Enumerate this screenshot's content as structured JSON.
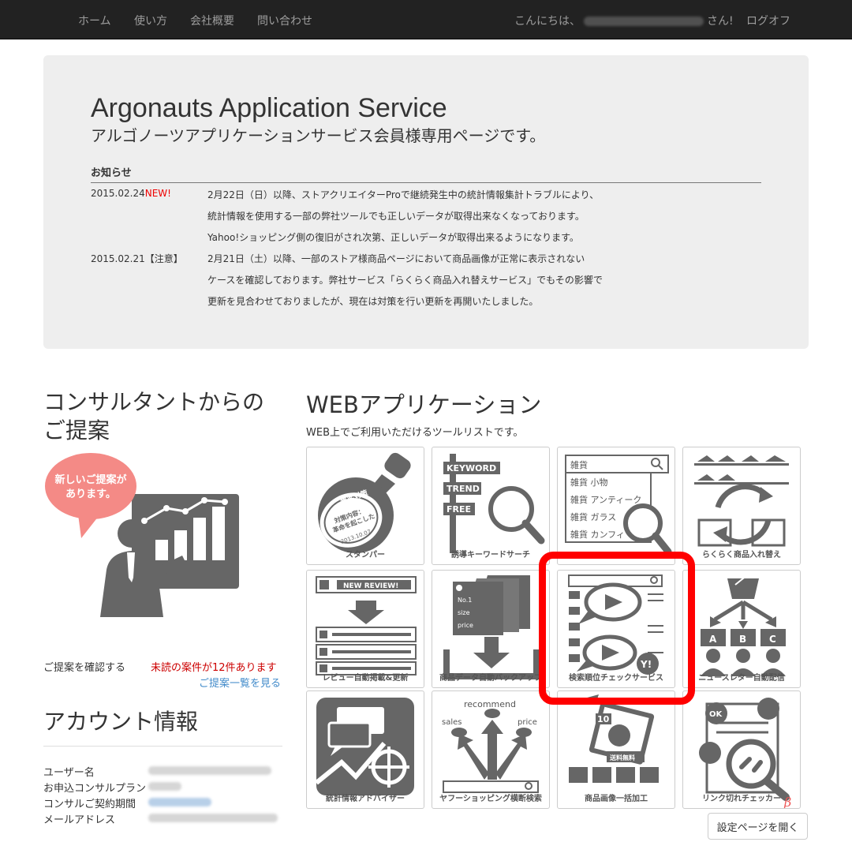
{
  "nav": {
    "items": [
      "ホーム",
      "使い方",
      "会社概要",
      "問い合わせ"
    ],
    "greeting_prefix": "こんにちは、",
    "greeting_suffix": "さん!",
    "logout": "ログオフ"
  },
  "hero": {
    "title": "Argonauts Application Service",
    "subtitle": "アルゴノーツアプリケーションサービス会員様専用ページです。",
    "notice_heading": "お知らせ",
    "notices": [
      {
        "date": "2015.02.24",
        "tag": "NEW!",
        "lines": [
          "2月22日（日）以降、ストアクリエイターProで継続発生中の統計情報集計トラブルにより、",
          "統計情報を使用する一部の弊社ツールでも正しいデータが取得出来なくなっております。",
          "Yahoo!ショッピング側の復旧がされ次第、正しいデータが取得出来るようになります。"
        ]
      },
      {
        "date": "2015.02.21",
        "tag": "【注意】",
        "lines": [
          "2月21日（土）以降、一部のストア様商品ページにおいて商品画像が正常に表示されない",
          "ケースを確認しております。弊社サービス「らくらく商品入れ替えサービス」でもその影響で",
          "更新を見合わせておりましたが、現在は対策を行い更新を再開いたしました。"
        ]
      }
    ]
  },
  "consultant": {
    "heading": "コンサルタントからのご提案",
    "bubble_line1": "新しいご提案が",
    "bubble_line2": "あります。",
    "confirm_label": "ご提案を確認する",
    "unread_label": "未読の案件が12件あります",
    "list_link": "ご提案一覧を見る"
  },
  "account": {
    "heading": "アカウント情報",
    "labels": [
      "ユーザー名",
      "お申込コンサルプラン",
      "コンサルご契約期間",
      "メールアドレス"
    ]
  },
  "webapps": {
    "heading": "WEBアプリケーション",
    "subtitle": "WEB上でご利用いただけるツールリストです。",
    "tiles": [
      {
        "label": "スタンパー",
        "icon": "stamp-icon"
      },
      {
        "label": "誘導キーワードサーチ",
        "icon": "keyword-sign-icon"
      },
      {
        "label": "",
        "icon": "search-dropdown-icon"
      },
      {
        "label": "らくらく商品入れ替え",
        "icon": "shoes-cycle-icon"
      },
      {
        "label": "レビュー自動掲載&更新",
        "icon": "review-list-icon"
      },
      {
        "label": "商品データ自動バックアップ",
        "icon": "tag-backup-icon"
      },
      {
        "label": "検索順位チェックサービス",
        "icon": "video-search-icon"
      },
      {
        "label": "ニュースレター自動配信",
        "icon": "newsletter-icon"
      },
      {
        "label": "統計情報アドバイザー",
        "icon": "stats-chat-icon"
      },
      {
        "label": "ヤフーショッピング横断検索",
        "icon": "recommend-arrows-icon"
      },
      {
        "label": "商品画像一括加工",
        "icon": "image-batch-icon"
      },
      {
        "label": "リンク切れチェッカー",
        "icon": "broken-link-icon"
      }
    ],
    "stamp_text": {
      "top": "集客対策",
      "mid1": "対策内容：",
      "mid2": "革命を起こした",
      "date": "2013.10.07"
    },
    "keyword_signs": [
      "KEYWORD",
      "TREND",
      "FREE"
    ],
    "dropdown": {
      "query": "雑貨",
      "options": [
        "雑貨 小物",
        "雑貨 アンティーク",
        "雑貨 ガラス",
        "雑貨 カンフィ"
      ]
    },
    "review_banner": "NEW REVIEW!",
    "tag_text": [
      "No.1",
      "size",
      "price"
    ],
    "newsletter_letters": [
      "A",
      "B",
      "C"
    ],
    "recommend_words": {
      "top": "recommend",
      "left": "sales",
      "right": "price"
    },
    "image_batch": {
      "badge": "10",
      "ribbon": "送料無料"
    },
    "link_checker": {
      "ok": "OK",
      "beta": "β"
    },
    "yahoo_badge": "Y!",
    "settings_button": "設定ページを開く"
  },
  "colors": {
    "navbar": "#222222",
    "jumbotron": "#eeeeee",
    "icon_gray": "#666666",
    "highlight": "#ff0000",
    "alert_red": "#cc0000",
    "link_blue": "#428bca",
    "bubble_pink": "#f48a86"
  }
}
